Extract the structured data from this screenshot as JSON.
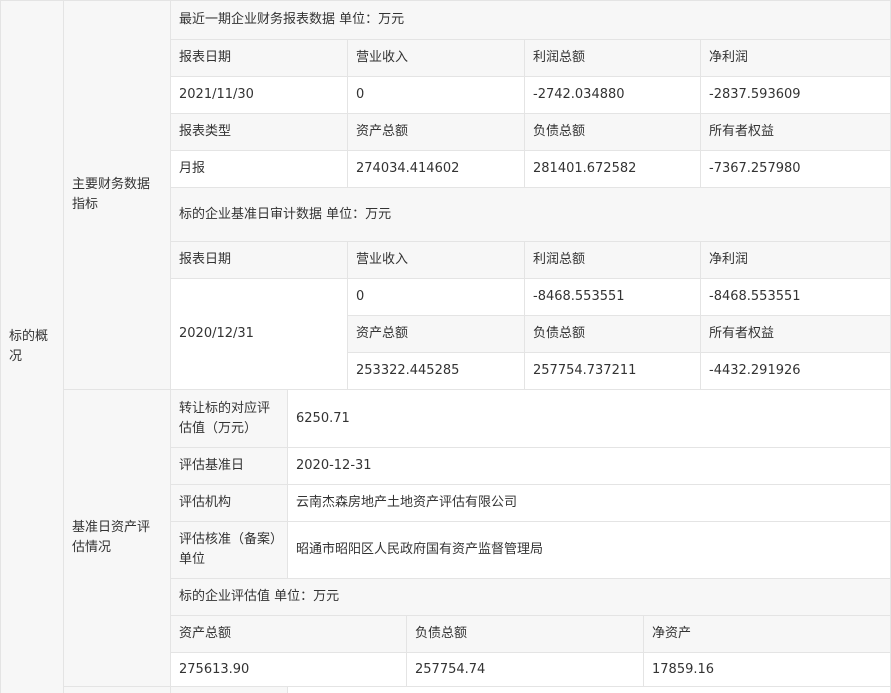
{
  "section": {
    "label": "标的概况"
  },
  "financial": {
    "label": "主要财务数据指标",
    "latest": {
      "title": "最近一期企业财务报表数据 单位：万元",
      "headers1": [
        "报表日期",
        "营业收入",
        "利润总额",
        "净利润"
      ],
      "row1": [
        "2021/11/30",
        "0",
        "-2742.034880",
        "-2837.593609"
      ],
      "headers2": [
        "报表类型",
        "资产总额",
        "负债总额",
        "所有者权益"
      ],
      "row2": [
        "月报",
        "274034.414602",
        "281401.672582",
        "-7367.257980"
      ]
    },
    "audit": {
      "title": "标的企业基准日审计数据 单位：万元",
      "headers1": [
        "报表日期",
        "营业收入",
        "利润总额",
        "净利润"
      ],
      "date": "2020/12/31",
      "row1": [
        "0",
        "-8468.553551",
        "-8468.553551"
      ],
      "headers2": [
        "资产总额",
        "负债总额",
        "所有者权益"
      ],
      "row2": [
        "253322.445285",
        "257754.737211",
        "-4432.291926"
      ]
    }
  },
  "valuation": {
    "label": "基准日资产评估情况",
    "rows": [
      {
        "label": "转让标的对应评估值（万元）",
        "value": "6250.71"
      },
      {
        "label": "评估基准日",
        "value": "2020-12-31"
      },
      {
        "label": "评估机构",
        "value": "云南杰森房地产土地资产评估有限公司"
      },
      {
        "label": "评估核准（备案）单位",
        "value": "昭通市昭阳区人民政府国有资产监督管理局"
      }
    ],
    "enterprise_title": "标的企业评估值 单位：万元",
    "enterprise_headers": [
      "资产总额",
      "负债总额",
      "净资产"
    ],
    "enterprise_values": [
      "275613.90",
      "257754.74",
      "17859.16"
    ]
  }
}
